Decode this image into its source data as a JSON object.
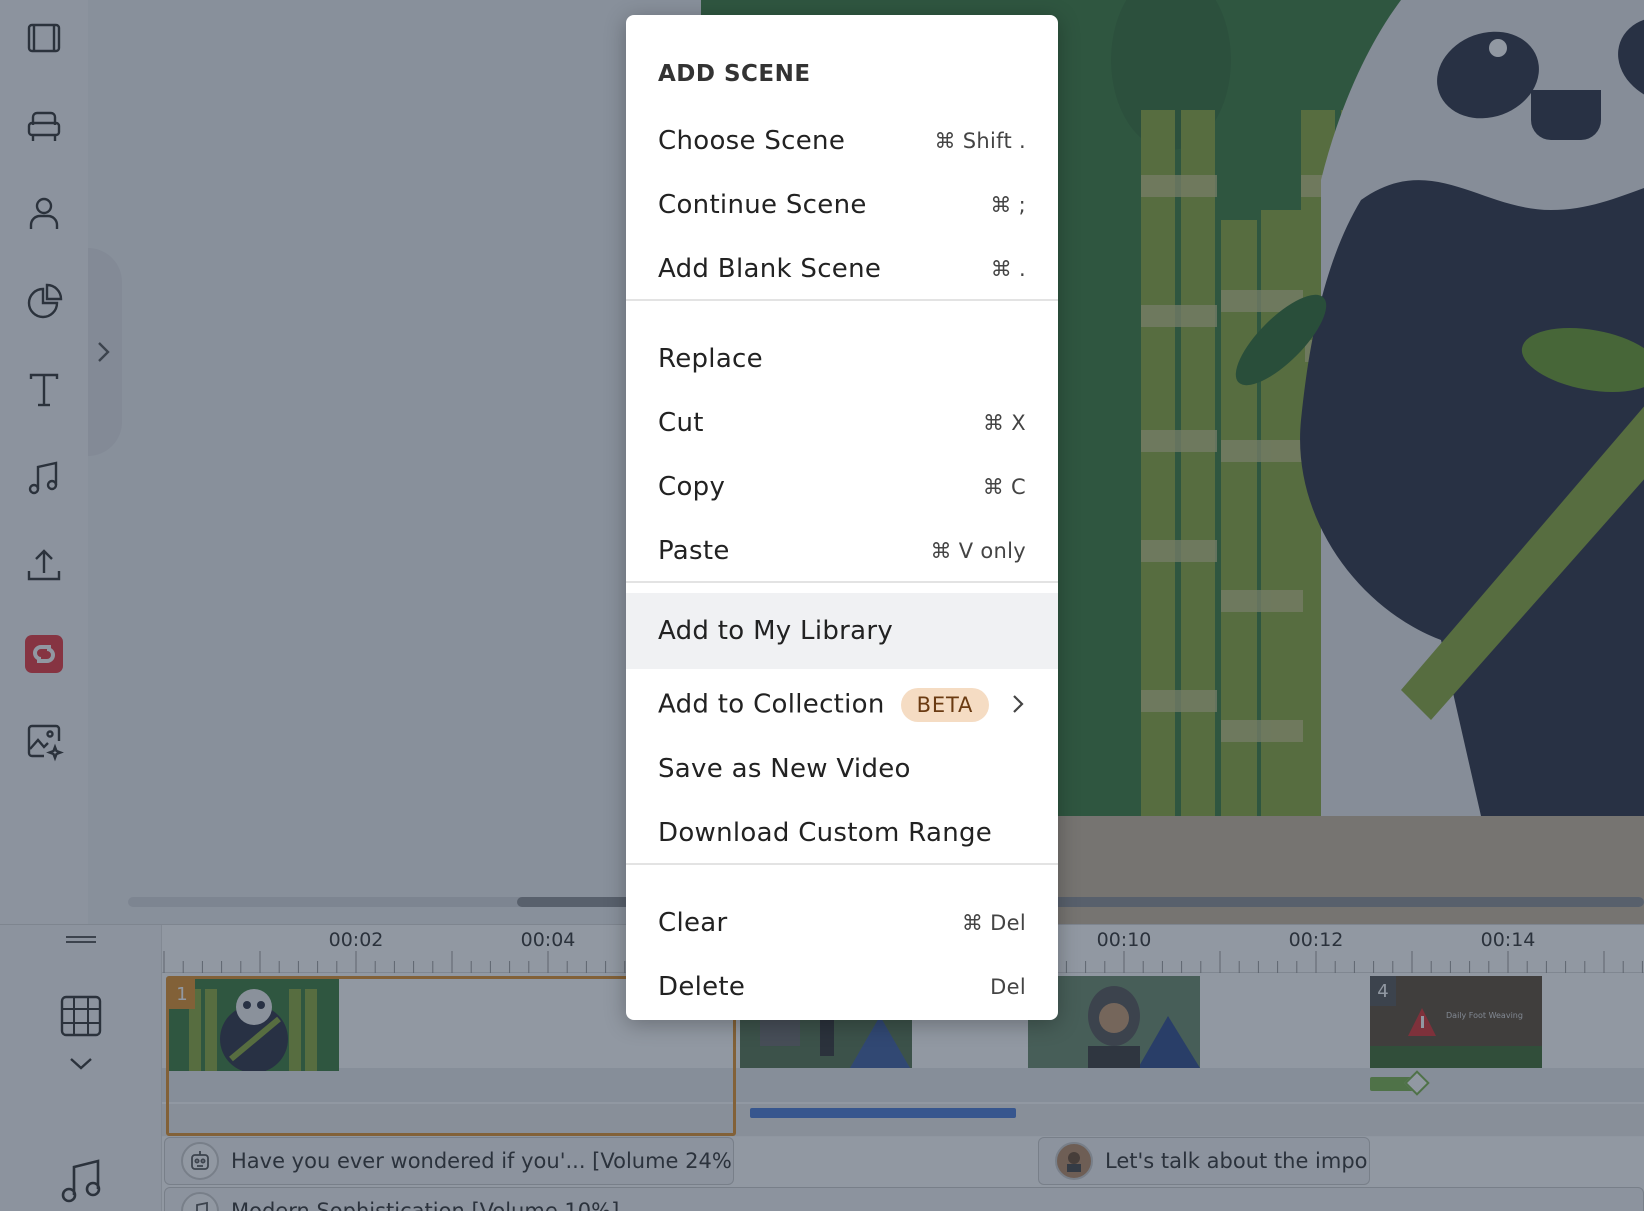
{
  "sidebar": {
    "items": [
      {
        "name": "scenes-icon",
        "icon": "film-frame"
      },
      {
        "name": "props-icon",
        "icon": "armchair"
      },
      {
        "name": "characters-icon",
        "icon": "person"
      },
      {
        "name": "charts-icon",
        "icon": "pie-chart"
      },
      {
        "name": "text-icon",
        "icon": "letter-t"
      },
      {
        "name": "audio-icon",
        "icon": "music-note"
      },
      {
        "name": "upload-icon",
        "icon": "upload-arrow"
      },
      {
        "name": "brand-app-icon",
        "icon": "red-logo",
        "color": "#e8363f"
      },
      {
        "name": "ai-image-icon",
        "icon": "image-sparkle"
      }
    ]
  },
  "context_menu": {
    "header": "ADD SCENE",
    "groups": [
      [
        {
          "label": "Choose Scene",
          "shortcut": "⌘ Shift ."
        },
        {
          "label": "Continue Scene",
          "shortcut": "⌘ ;"
        },
        {
          "label": "Add Blank Scene",
          "shortcut": "⌘ ."
        }
      ],
      [
        {
          "label": "Replace",
          "shortcut": ""
        },
        {
          "label": "Cut",
          "shortcut": "⌘ X"
        },
        {
          "label": "Copy",
          "shortcut": "⌘ C"
        },
        {
          "label": "Paste",
          "shortcut": "⌘ V only"
        }
      ],
      [
        {
          "label": "Add to My Library",
          "shortcut": "",
          "highlighted": true
        },
        {
          "label": "Add to Collection",
          "badge": "BETA",
          "submenu": true
        },
        {
          "label": "Save as New Video",
          "shortcut": ""
        },
        {
          "label": "Download Custom Range",
          "shortcut": ""
        }
      ],
      [
        {
          "label": "Clear",
          "shortcut": "⌘ Del"
        },
        {
          "label": "Delete",
          "shortcut": "Del"
        }
      ]
    ]
  },
  "timeline": {
    "ticks": [
      "00:02",
      "00:04",
      "00:10",
      "00:12",
      "00:14"
    ],
    "scenes": [
      {
        "number": "1",
        "selected": true
      },
      {
        "number": ""
      },
      {
        "number": ""
      },
      {
        "number": "4",
        "thumbnail_text": "Daily Foot Weaving"
      }
    ],
    "audio": [
      {
        "label": "Have you ever wondered if you'... [Volume 24%]"
      },
      {
        "label": "Let's talk about the impo"
      },
      {
        "label": "Modern Sophistication [Volume 10%]"
      }
    ]
  },
  "colors": {
    "accent_selected": "#e0902a",
    "transition_bar": "#4a7bd6",
    "badge_bg": "#f5dcc3",
    "scene_green": "#3a7a3a"
  }
}
